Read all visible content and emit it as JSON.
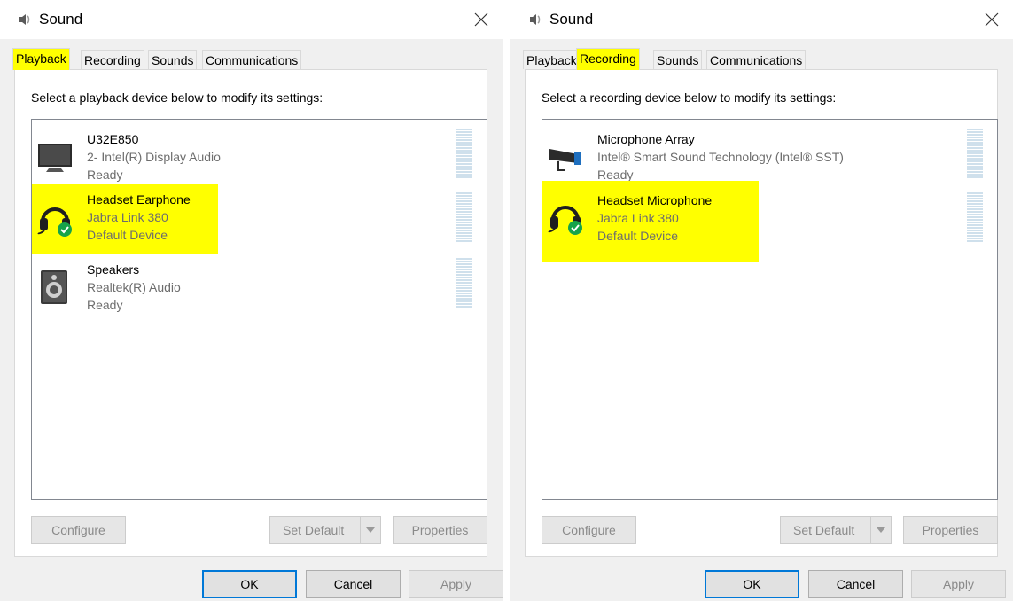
{
  "dialogs": [
    {
      "title": "Sound",
      "tabs": [
        {
          "label": "Playback",
          "active": true,
          "highlighted": true
        },
        {
          "label": "Recording",
          "active": false,
          "highlighted": false
        },
        {
          "label": "Sounds",
          "active": false,
          "highlighted": false
        },
        {
          "label": "Communications",
          "active": false,
          "highlighted": false
        }
      ],
      "instruction": "Select a playback device below to modify its settings:",
      "devices": [
        {
          "name": "U32E850",
          "description": "2- Intel(R) Display Audio",
          "status": "Ready",
          "icon": "monitor-icon",
          "default": false,
          "highlighted": false
        },
        {
          "name": "Headset Earphone",
          "description": "Jabra Link 380",
          "status": "Default Device",
          "icon": "headset-icon",
          "default": true,
          "highlighted": true
        },
        {
          "name": "Speakers",
          "description": "Realtek(R) Audio",
          "status": "Ready",
          "icon": "speaker-icon",
          "default": false,
          "highlighted": false
        }
      ],
      "buttons": {
        "configure": "Configure",
        "set_default": "Set Default",
        "properties": "Properties",
        "ok": "OK",
        "cancel": "Cancel",
        "apply": "Apply"
      }
    },
    {
      "title": "Sound",
      "tabs": [
        {
          "label": "Playback",
          "active": false,
          "highlighted": false
        },
        {
          "label": "Recording",
          "active": true,
          "highlighted": true
        },
        {
          "label": "Sounds",
          "active": false,
          "highlighted": false
        },
        {
          "label": "Communications",
          "active": false,
          "highlighted": false
        }
      ],
      "instruction": "Select a recording device below to modify its settings:",
      "devices": [
        {
          "name": "Microphone Array",
          "description": "Intel® Smart Sound Technology (Intel® SST)",
          "status": "Ready",
          "icon": "microphone-array-icon",
          "default": false,
          "highlighted": false
        },
        {
          "name": "Headset Microphone",
          "description": "Jabra Link 380",
          "status": "Default Device",
          "icon": "headset-icon",
          "default": true,
          "highlighted": true
        }
      ],
      "buttons": {
        "configure": "Configure",
        "set_default": "Set Default",
        "properties": "Properties",
        "ok": "OK",
        "cancel": "Cancel",
        "apply": "Apply"
      }
    }
  ],
  "colors": {
    "highlight": "#ffff00",
    "accent": "#0078d7",
    "default_check": "#16a34a",
    "disabled_text": "#8a8a8a",
    "meter": "#cfe0ec"
  }
}
